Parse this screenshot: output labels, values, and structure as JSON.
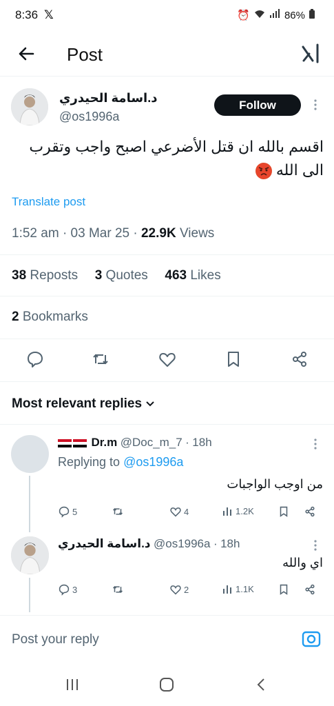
{
  "status": {
    "time": "8:36",
    "x_glyph": "𝕏",
    "battery": "86%"
  },
  "header": {
    "title": "Post"
  },
  "post": {
    "author_name": "د.اسامة الحيدري",
    "handle": "@os1996a",
    "follow_label": "Follow",
    "text_line1": "اقسم بالله ان قتل الأضرعي اصبح واجب وتقرب",
    "text_line2": "الى الله",
    "translate_label": "Translate post",
    "time": "1:52 am",
    "date": "03 Mar 25",
    "views_count": "22.9K",
    "views_label": "Views",
    "reposts_count": "38",
    "reposts_label": "Reposts",
    "quotes_count": "3",
    "quotes_label": "Quotes",
    "likes_count": "463",
    "likes_label": "Likes",
    "bookmarks_count": "2",
    "bookmarks_label": "Bookmarks"
  },
  "replies_header": "Most relevant replies",
  "replies": [
    {
      "name": "Dr.m",
      "handle": "@Doc_m_7",
      "time": "18h",
      "replying_prefix": "Replying to",
      "replying_to": "@os1996a",
      "text": "من اوجب الواجبات",
      "replies": "5",
      "likes": "4",
      "views": "1.2K"
    },
    {
      "name": "د.اسامة الحيدري",
      "handle": "@os1996a",
      "time": "18h",
      "text": "اي والله",
      "replies": "3",
      "likes": "2",
      "views": "1.1K"
    }
  ],
  "compose": {
    "placeholder": "Post your reply"
  },
  "colors": {
    "accent": "#1d9bf0",
    "text": "#0f1419",
    "muted": "#536471"
  }
}
